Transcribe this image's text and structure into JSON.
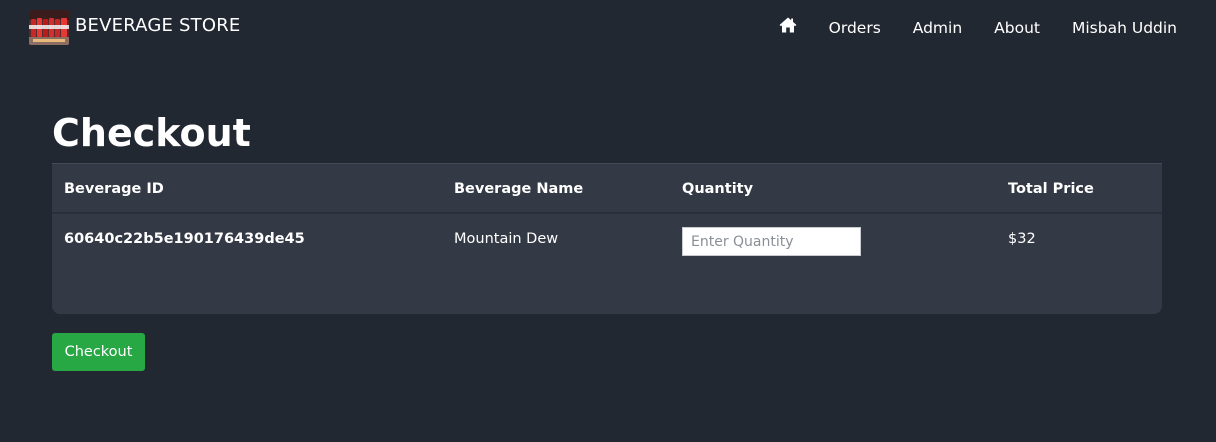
{
  "navbar": {
    "brand_name": "BEVERAGE STORE",
    "logo_icon": "beverage-store-logo",
    "home_icon": "home-icon",
    "links": {
      "orders": "Orders",
      "admin": "Admin",
      "about": "About",
      "user": "Misbah Uddin"
    }
  },
  "page": {
    "title": "Checkout"
  },
  "table": {
    "headers": {
      "beverage_id": "Beverage ID",
      "beverage_name": "Beverage Name",
      "quantity": "Quantity",
      "total_price": "Total Price"
    },
    "rows": [
      {
        "beverage_id": "60640c22b5e190176439de45",
        "beverage_name": "Mountain Dew",
        "quantity_value": "",
        "quantity_placeholder": "Enter Quantity",
        "total_price": "$32"
      }
    ]
  },
  "actions": {
    "checkout_label": "Checkout"
  },
  "colors": {
    "background": "#222831",
    "card": "#343a45",
    "checkout_button": "#28a745",
    "text": "#ffffff"
  }
}
